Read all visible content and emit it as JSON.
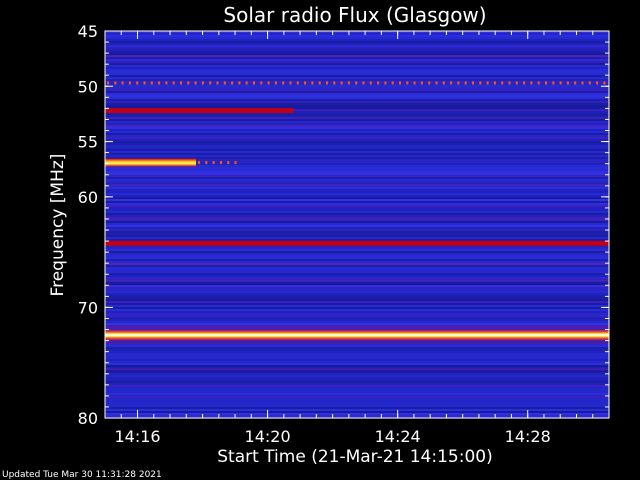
{
  "chart_data": {
    "type": "heatmap",
    "title": "Solar radio Flux (Glasgow)",
    "xlabel": "Start Time (21-Mar-21 14:15:00)",
    "ylabel": "Frequency [MHz]",
    "x_range_minutes": [
      0,
      15.5
    ],
    "x_ticks": [
      {
        "minute": 1,
        "label": "14:16"
      },
      {
        "minute": 5,
        "label": "14:20"
      },
      {
        "minute": 9,
        "label": "14:24"
      },
      {
        "minute": 13,
        "label": "14:28"
      }
    ],
    "ylim": [
      45,
      80
    ],
    "y_axis_inverted": true,
    "y_ticks": [
      45,
      50,
      55,
      60,
      70,
      80
    ],
    "colormap": [
      "#1a1a8c",
      "#3030d8",
      "#7a1fb0",
      "#c80020",
      "#ff6a00",
      "#ffff40",
      "#ffffff"
    ],
    "background_color": "#1e22b8",
    "bands": [
      {
        "freq": 49.7,
        "start_min": 0,
        "end_min": 15.5,
        "intensity": "dotted-medium"
      },
      {
        "freq": 52.2,
        "start_min": 0,
        "end_min": 5.8,
        "intensity": "medium"
      },
      {
        "freq": 56.9,
        "start_min": 0,
        "end_min": 2.8,
        "intensity": "high"
      },
      {
        "freq": 56.9,
        "start_min": 2.8,
        "end_min": 4.2,
        "intensity": "dotted-medium"
      },
      {
        "freq": 64.2,
        "start_min": 0,
        "end_min": 15.5,
        "intensity": "medium"
      },
      {
        "freq": 72.5,
        "start_min": 0,
        "end_min": 15.5,
        "intensity": "very-high"
      }
    ]
  },
  "footer": {
    "updated": "Updated Tue Mar 30 11:31:28 2021"
  }
}
